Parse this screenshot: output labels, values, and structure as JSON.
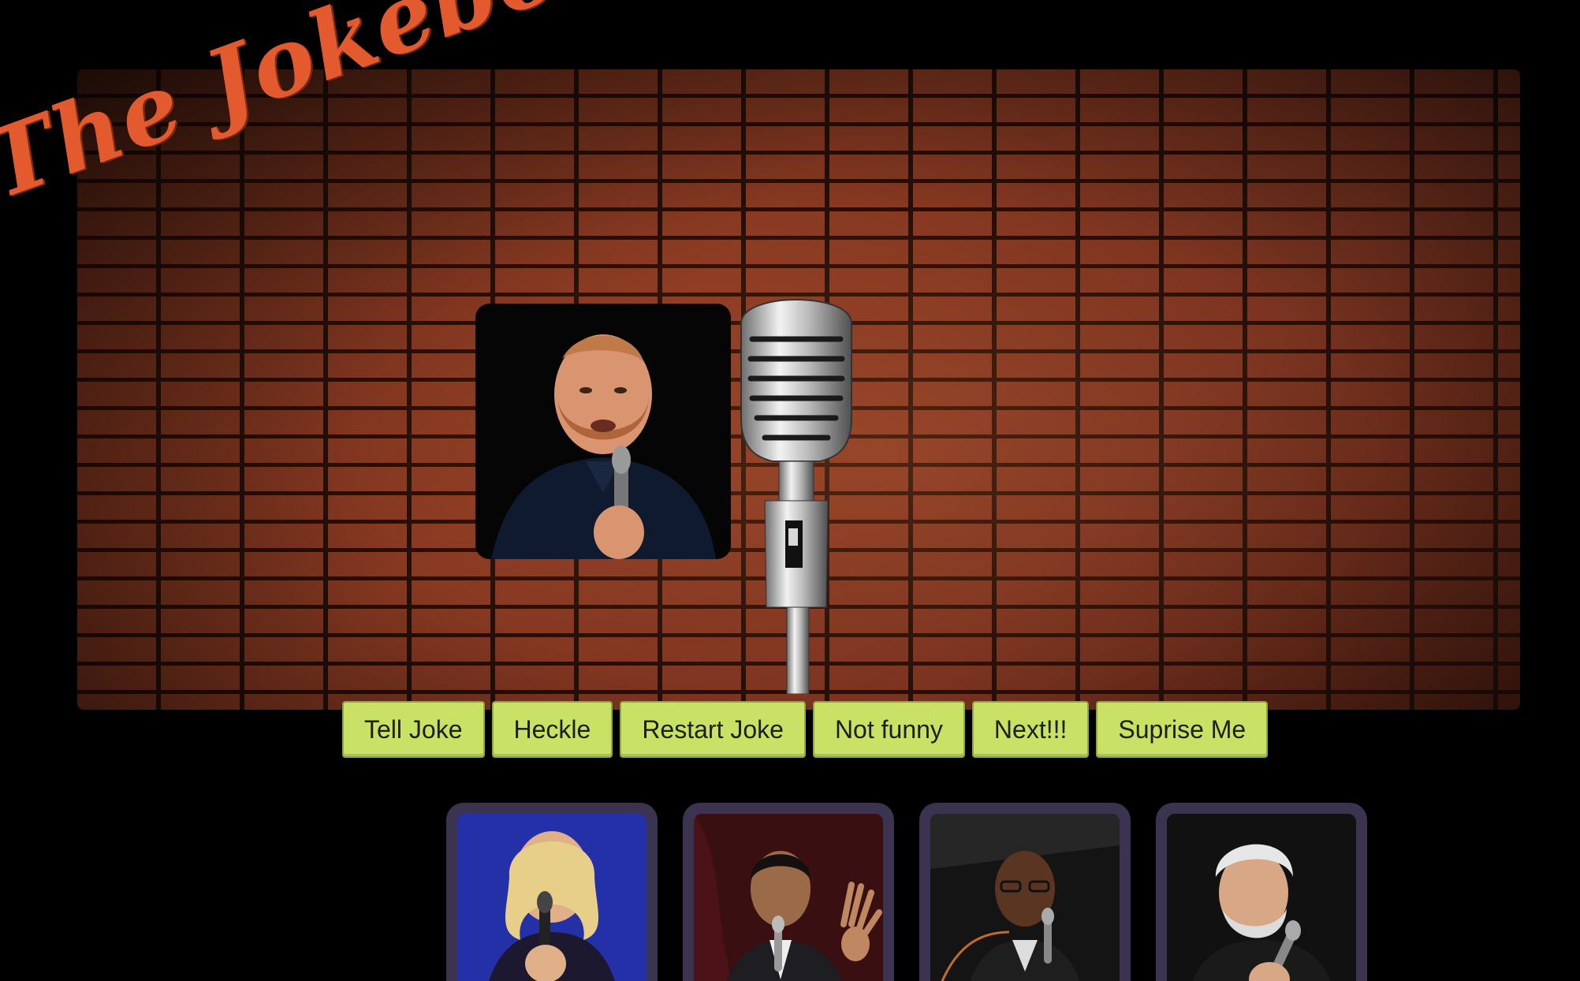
{
  "header": {
    "title": "The Jokebox"
  },
  "stage": {
    "current_comedian_icon": "comedian-portrait",
    "microphone_icon": "vintage-microphone"
  },
  "controls": {
    "buttons": [
      {
        "label": "Tell Joke"
      },
      {
        "label": "Heckle"
      },
      {
        "label": "Restart Joke"
      },
      {
        "label": "Not funny"
      },
      {
        "label": "Next!!!"
      },
      {
        "label": "Suprise Me"
      }
    ]
  },
  "comedians": [
    {
      "icon": "comedian-photo-1",
      "bg": "#2430a8"
    },
    {
      "icon": "comedian-photo-2",
      "bg": "#3a0f12"
    },
    {
      "icon": "comedian-photo-3",
      "bg": "#141414"
    },
    {
      "icon": "comedian-photo-4",
      "bg": "#111111"
    }
  ],
  "colors": {
    "title": "#e35a2e",
    "button_bg": "#c9e265",
    "card_frame": "#3b3350",
    "page_bg": "#000000"
  }
}
